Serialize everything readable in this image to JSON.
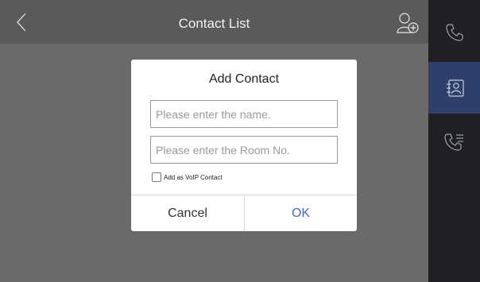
{
  "header": {
    "title": "Contact List",
    "back_icon": "chevron-left-icon",
    "add_icon": "add-user-icon"
  },
  "sidebar": {
    "items": [
      {
        "icon": "phone-icon",
        "active": false
      },
      {
        "icon": "contacts-icon",
        "active": true
      },
      {
        "icon": "call-log-icon",
        "active": false
      }
    ]
  },
  "dialog": {
    "title": "Add Contact",
    "name_placeholder": "Please enter the name.",
    "room_placeholder": "Please enter the Room No.",
    "voip_label": "Add as VoIP Contact",
    "voip_checked": false,
    "cancel_label": "Cancel",
    "ok_label": "OK"
  },
  "colors": {
    "accent": "#3b67d9",
    "sidebar_active": "#2f3f6b",
    "sidebar_bg": "#1f1f24"
  }
}
